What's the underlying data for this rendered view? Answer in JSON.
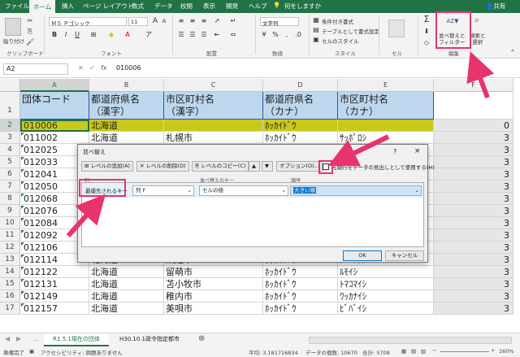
{
  "tabs": [
    "ファイル",
    "ホーム",
    "挿入",
    "ページ レイアウト",
    "数式",
    "データ",
    "校閲",
    "表示",
    "開発",
    "ヘルプ"
  ],
  "tell_me": "何をしますか",
  "share": "共有",
  "ribbon": {
    "paste": "貼り付け",
    "clipboard": "クリップボード",
    "font_name": "ＭＳ Ｐゴシック",
    "font_size": "11",
    "font_label": "フォント",
    "align_label": "配置",
    "number_format": "文字列",
    "number_label": "数値",
    "cond_format": "条件付き書式",
    "table_format": "テーブルとして書式設定",
    "cell_style": "セルのスタイル",
    "style_label": "スタイル",
    "cells": "セル",
    "sort_filter": "並べ替えと\nフィルター",
    "find_select": "検索と\n選択",
    "edit_label": "編集"
  },
  "formula_bar": {
    "name_box": "A2",
    "fx": "fx",
    "value": "010006"
  },
  "columns": [
    "A",
    "B",
    "C",
    "D",
    "E",
    "F"
  ],
  "rows": [
    {
      "num": "1",
      "a": "団体コード",
      "b": "都道府県名\n（漢字）",
      "c": "市区町村名\n（漢字）",
      "d": "都道府県名\n（カナ）",
      "e": "市区町村名\n（カナ）",
      "f": ""
    },
    {
      "num": "2",
      "a": "010006",
      "b": "北海道",
      "c": "",
      "d": "ﾎｯｶｲﾄﾞｳ",
      "e": "",
      "f": "0"
    },
    {
      "num": "3",
      "a": "011002",
      "b": "北海道",
      "c": "札幌市",
      "d": "ﾎｯｶｲﾄﾞｳ",
      "e": "ｻｯﾎﾟﾛｼ",
      "f": "3"
    },
    {
      "num": "4",
      "a": "012025",
      "b": "",
      "c": "",
      "d": "",
      "e": "",
      "f": "3"
    },
    {
      "num": "5",
      "a": "012033",
      "b": "",
      "c": "",
      "d": "",
      "e": "",
      "f": "3"
    },
    {
      "num": "6",
      "a": "012041",
      "b": "",
      "c": "",
      "d": "",
      "e": "",
      "f": "3"
    },
    {
      "num": "7",
      "a": "012050",
      "b": "",
      "c": "",
      "d": "",
      "e": "",
      "f": "3"
    },
    {
      "num": "8",
      "a": "012068",
      "b": "",
      "c": "",
      "d": "",
      "e": "",
      "f": "3"
    },
    {
      "num": "9",
      "a": "012076",
      "b": "",
      "c": "",
      "d": "",
      "e": "",
      "f": "3"
    },
    {
      "num": "10",
      "a": "012084",
      "b": "",
      "c": "",
      "d": "",
      "e": "",
      "f": "3"
    },
    {
      "num": "11",
      "a": "012092",
      "b": "",
      "c": "",
      "d": "",
      "e": "",
      "f": "3"
    },
    {
      "num": "12",
      "a": "012106",
      "b": "",
      "c": "",
      "d": "",
      "e": "",
      "f": "3"
    },
    {
      "num": "13",
      "a": "012114",
      "b": "北海道",
      "c": "網走市",
      "d": "ﾎｯｶｲﾄﾞｳ",
      "e": "ｱﾊﾞｼﾘｼ",
      "f": "3"
    },
    {
      "num": "14",
      "a": "012122",
      "b": "北海道",
      "c": "留萌市",
      "d": "ﾎｯｶｲﾄﾞｳ",
      "e": "ﾙﾓｲｼ",
      "f": "3"
    },
    {
      "num": "15",
      "a": "012131",
      "b": "北海道",
      "c": "苫小牧市",
      "d": "ﾎｯｶｲﾄﾞｳ",
      "e": "ﾄﾏｺﾏｲｼ",
      "f": "3"
    },
    {
      "num": "16",
      "a": "012149",
      "b": "北海道",
      "c": "稚内市",
      "d": "ﾎｯｶｲﾄﾞｳ",
      "e": "ﾜｯｶﾅｲｼ",
      "f": "3"
    },
    {
      "num": "17",
      "a": "012157",
      "b": "北海道",
      "c": "美唄市",
      "d": "ﾎｯｶｲﾄﾞｳ",
      "e": "ﾋﾞﾊﾞｲｼ",
      "f": "3"
    }
  ],
  "dialog": {
    "title": "並べ替え",
    "help": "?",
    "close": "×",
    "add_level": "レベルの追加(A)",
    "delete_level": "レベルの削除(D)",
    "copy_level": "レベルのコピー(C)",
    "options": "オプション(O)...",
    "header_checkbox": "先頭行をデータの見出しとして使用する(H)",
    "col_header": "列",
    "sortkey_header": "並べ替えのキー",
    "order_header": "順序",
    "priority": "最優先されるキー",
    "column_value": "列 F",
    "sortkey_value": "セルの値",
    "order_value": "大きい順",
    "ok": "OK",
    "cancel": "キャンセル"
  },
  "sheets": [
    "R1.5.1現在の団体",
    "H30.10.1政令指定都市"
  ],
  "status": {
    "ready": "準備完了",
    "accessibility": "アクセシビリティ: 問題ありません",
    "average": "平均: 3.181716834",
    "count": "データの個数: 10670",
    "sum": "合計: 5708",
    "zoom": "160%"
  },
  "colors": {
    "excel_green": "#217346",
    "header_fill": "#bdd7ee",
    "highlight": "#c9c91b",
    "annotation": "#e8336d"
  }
}
